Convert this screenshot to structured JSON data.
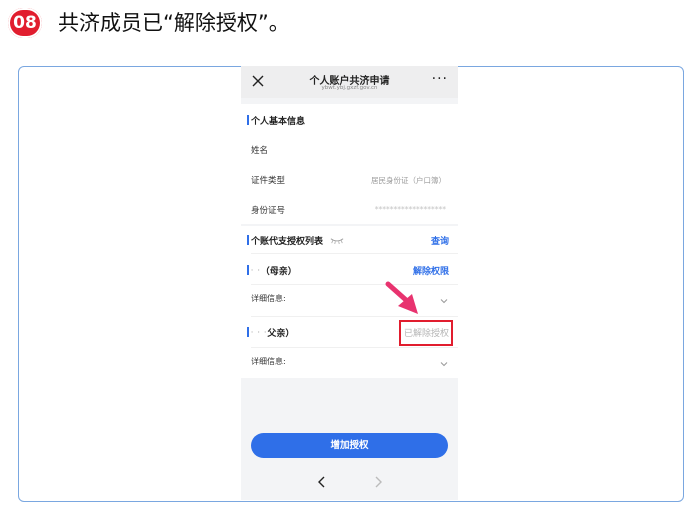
{
  "step": {
    "number": "08",
    "title": "共济成员已“解除授权”。"
  },
  "app": {
    "title": "个人账户共济申请",
    "url": "ybwt.ybj.gxzf.gov.cn",
    "more_label": "···"
  },
  "basic_info": {
    "heading": "个人基本信息",
    "name_label": "姓名",
    "name_value": "",
    "id_type_label": "证件类型",
    "id_type_value": "居民身份证（户口簿）",
    "id_number_label": "身份证号",
    "id_number_value": "*******************"
  },
  "auth_list": {
    "heading": "个账代支授权列表",
    "query_label": "查询",
    "members": [
      {
        "name_masked": "' '",
        "relation": "（母亲）",
        "action": "解除权限",
        "detail_label": "详细信息:"
      },
      {
        "name_masked": "' ' '",
        "relation": "父亲）",
        "action": "已解除授权",
        "detail_label": "详细信息:"
      }
    ]
  },
  "add_button": "增加授权",
  "colors": {
    "accent": "#2f6fe8",
    "badge": "#e11d2e",
    "frame": "#7aa7e0"
  },
  "icons": [
    "close-icon",
    "more-icon",
    "chevron-down-icon",
    "nav-back-icon",
    "nav-forward-icon",
    "eye-closed-icon",
    "pointer-arrow"
  ]
}
